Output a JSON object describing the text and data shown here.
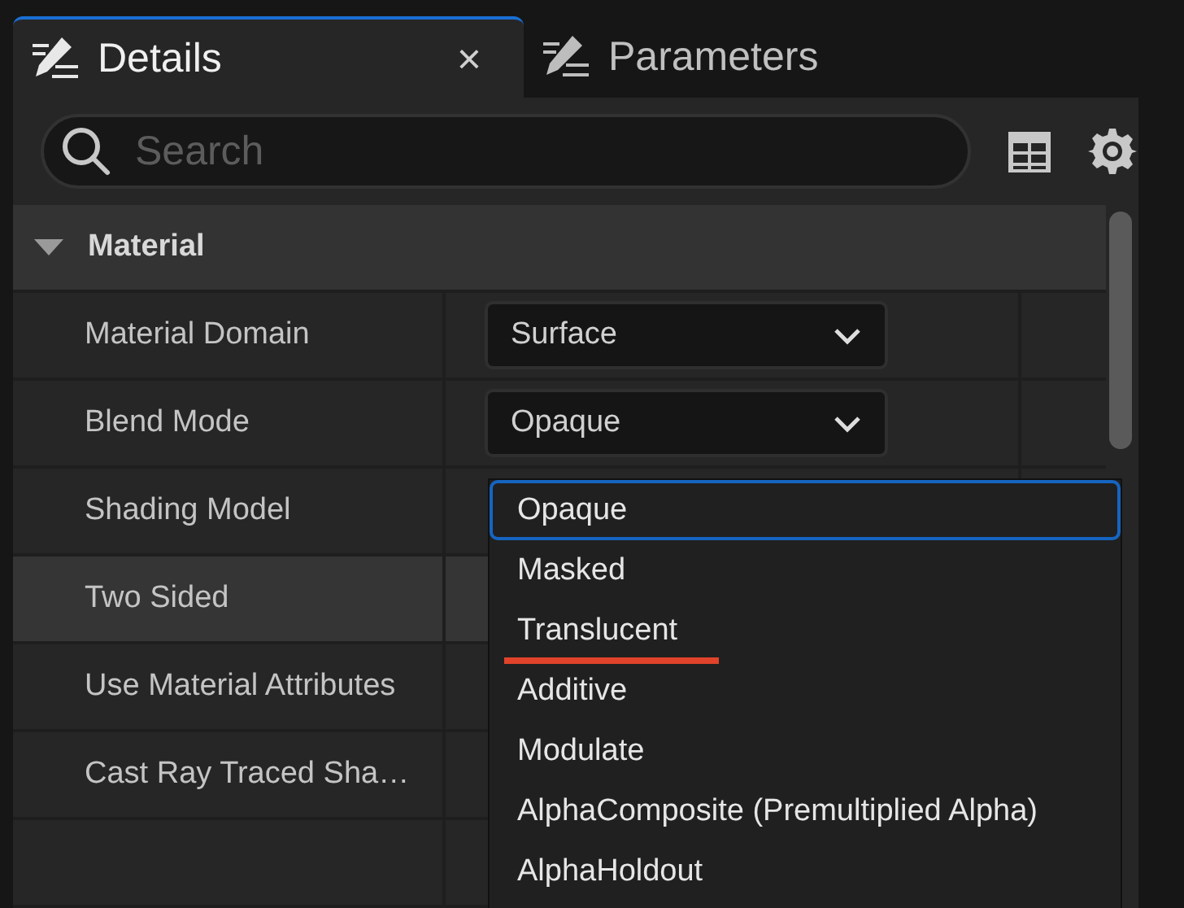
{
  "tabs": [
    {
      "label": "Details",
      "selected": true,
      "close": "×"
    },
    {
      "label": "Parameters",
      "selected": false
    }
  ],
  "search": {
    "placeholder": "Search"
  },
  "section": {
    "title": "Material",
    "expanded": true
  },
  "rows": [
    {
      "kind": "combo",
      "label": "Material Domain",
      "value": "Surface",
      "hovered": false
    },
    {
      "kind": "combo",
      "label": "Blend Mode",
      "value": "Opaque",
      "hovered": false
    },
    {
      "kind": "plain",
      "label": "Shading Model",
      "hovered": false
    },
    {
      "kind": "plain",
      "label": "Two Sided",
      "hovered": true
    },
    {
      "kind": "plain",
      "label": "Use Material Attributes",
      "hovered": false
    },
    {
      "kind": "plain",
      "label": "Cast Ray Traced Sha…",
      "hovered": false
    },
    {
      "kind": "plain",
      "hovered": false
    }
  ],
  "dropdown": {
    "items": [
      {
        "label": "Opaque",
        "selected": true,
        "underlined": false
      },
      {
        "label": "Masked",
        "selected": false,
        "underlined": false
      },
      {
        "label": "Translucent",
        "selected": false,
        "underlined": true
      },
      {
        "label": "Additive",
        "selected": false,
        "underlined": false
      },
      {
        "label": "Modulate",
        "selected": false,
        "underlined": false
      },
      {
        "label": "AlphaComposite (Premultiplied Alpha)",
        "selected": false,
        "underlined": false
      },
      {
        "label": "AlphaHoldout",
        "selected": false,
        "underlined": false
      }
    ]
  }
}
